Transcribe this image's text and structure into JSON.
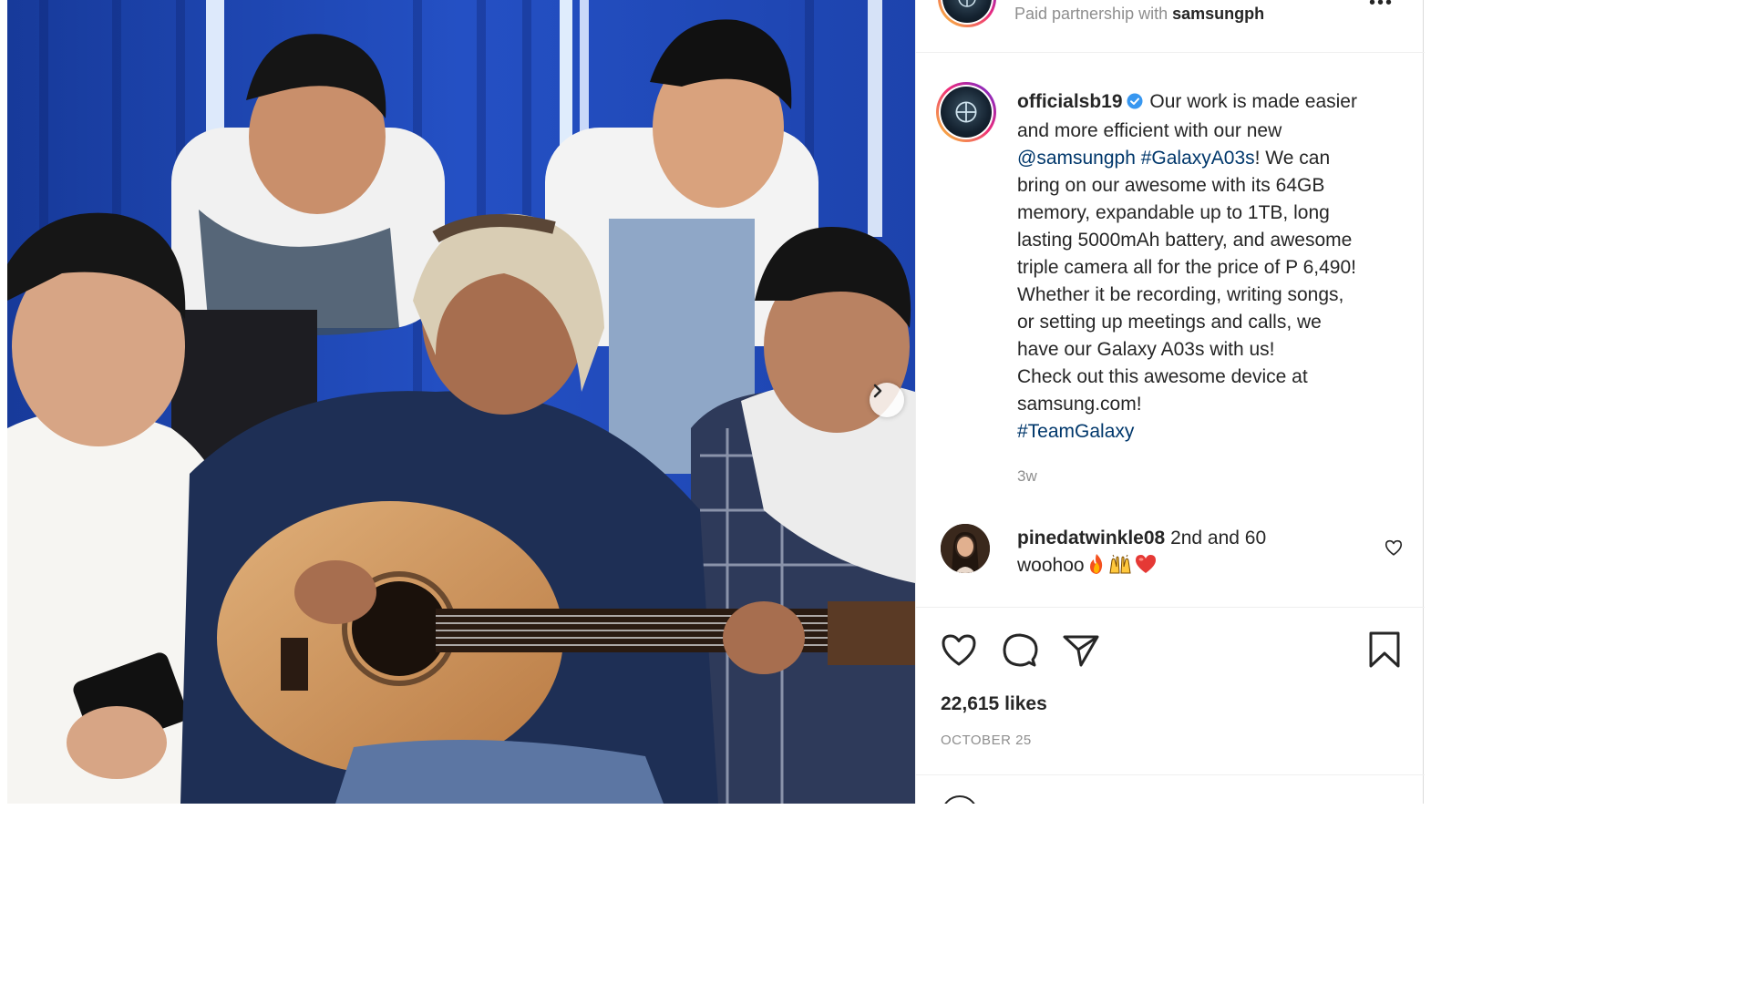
{
  "post": {
    "header": {
      "paid_prefix": "Paid partnership with",
      "partner": "samsungph"
    },
    "caption": {
      "username": "officialsb19",
      "lines": [
        "Our work is made easier",
        "and more efficient with our new",
        "@samsungph",
        "#GalaxyA03s",
        "! We can",
        "bring on our awesome with its 64GB",
        "memory, expandable up to 1TB, long",
        "lasting 5000mAh battery, and awesome",
        "triple camera all for the price of P 6,490!",
        "Whether it be recording, writing songs,",
        "or setting up meetings and calls, we",
        "have our Galaxy A03s with us!",
        "Check out this awesome device at",
        "samsung.com!",
        "#TeamGalaxy"
      ],
      "time_ago": "3w"
    },
    "comment": {
      "username": "pinedatwinkle08",
      "text_line1": "2nd and 60",
      "text_line2": "woohoo",
      "emoji_icons": [
        "fire-emoji",
        "raising-hands-emoji",
        "red-heart-emoji"
      ]
    },
    "likes": "22,615 likes",
    "date": "OCTOBER 25"
  },
  "colors": {
    "link": "#00376b",
    "secondary_text": "#8e8e8e",
    "verified": "#3897f0",
    "background_curtain": "#1f3f9c"
  },
  "icons": {
    "actions": [
      "heart-icon",
      "comment-icon",
      "share-icon",
      "bookmark-icon"
    ],
    "media": [
      "next-arrow-icon"
    ]
  }
}
